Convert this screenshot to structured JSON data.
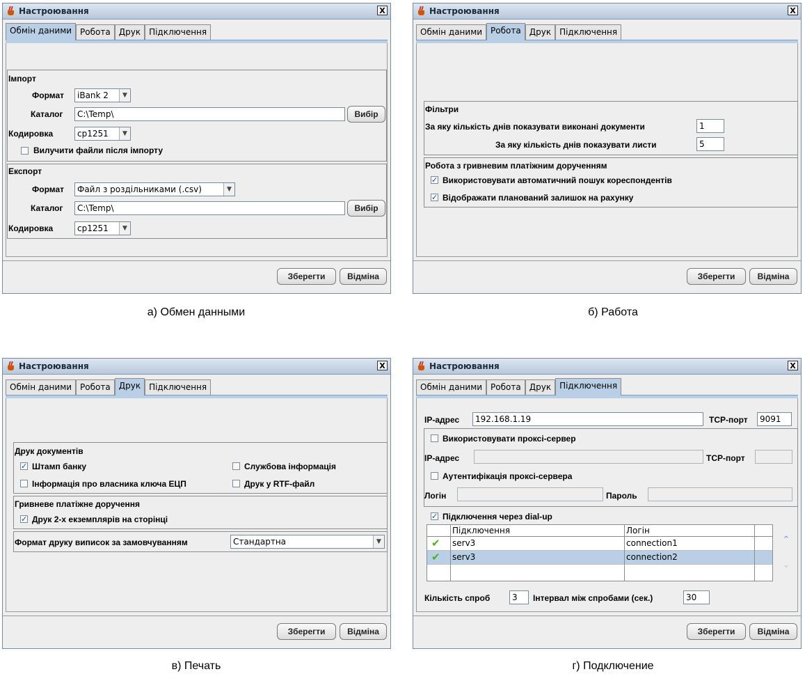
{
  "window_title": "Настроювання",
  "close_label": "X",
  "tabs": [
    "Обмін даними",
    "Робота",
    "Друк",
    "Підключення"
  ],
  "buttons": {
    "save": "Зберегти",
    "cancel": "Відміна"
  },
  "captions": {
    "a": "а) Обмен данными",
    "b": "б) Работа",
    "c": "в) Печать",
    "d": "г) Подключение"
  },
  "exchange": {
    "import": {
      "title": "Імпорт",
      "format_label": "Формат",
      "format_value": "iBank 2",
      "catalog_label": "Каталог",
      "catalog_value": "C:\\Temp\\",
      "browse": "Вибір",
      "encoding_label": "Кодировка",
      "encoding_value": "cp1251",
      "delete_label": "Вилучити файли після імпорту",
      "delete_checked": false
    },
    "export": {
      "title": "Експорт",
      "format_label": "Формат",
      "format_value": "Файл з роздільниками (.csv)",
      "catalog_label": "Каталог",
      "catalog_value": "C:\\Temp\\",
      "browse": "Вибір",
      "encoding_label": "Кодировка",
      "encoding_value": "cp1251"
    }
  },
  "work": {
    "filters": {
      "title": "Фільтри",
      "executed_label": "За яку кількість днів показувати виконані документи",
      "executed_value": "1",
      "letters_label": "За яку кількість днів показувати листи",
      "letters_value": "5"
    },
    "payment": {
      "title": "Робота з гривневим платіжним дорученням",
      "auto_search_label": "Використовувати автоматичний пошук кореспондентів",
      "auto_search_checked": true,
      "planned_balance_label": "Відображати планований залишок на рахунку",
      "planned_balance_checked": true
    }
  },
  "print": {
    "docs": {
      "title": "Друк документів",
      "stamp_label": "Штамп банку",
      "stamp_checked": true,
      "service_label": "Службова інформація",
      "service_checked": false,
      "owner_label": "Інформація про власника ключа ЕЦП",
      "owner_checked": false,
      "rtf_label": "Друк у RTF-файл",
      "rtf_checked": false
    },
    "payment": {
      "title": "Гривневе платіжне доручення",
      "two_copies_label": "Друк 2-х екземплярів на сторінці",
      "two_copies_checked": true
    },
    "statement_format_label": "Формат друку виписок за замовчуванням",
    "statement_format_value": "Стандартна"
  },
  "connection": {
    "ip_label": "IP-адрес",
    "ip_value": "192.168.1.19",
    "port_label": "TCP-порт",
    "port_value": "9091",
    "proxy": {
      "use_label": "Використовувати проксі-сервер",
      "use_checked": false,
      "ip_label": "IP-адрес",
      "ip_value": "",
      "port_label": "TCP-порт",
      "port_value": "",
      "auth_label": "Аутентифікація проксі-сервера",
      "auth_checked": false,
      "login_label": "Логін",
      "login_value": "",
      "password_label": "Пароль",
      "password_value": ""
    },
    "dialup": {
      "label": "Підключення через dial-up",
      "checked": true,
      "columns": [
        "Підключення",
        "Логін"
      ],
      "rows": [
        {
          "connection": "serv3",
          "login": "connection1",
          "selected": false
        },
        {
          "connection": "serv3",
          "login": "connection2",
          "selected": true
        }
      ]
    },
    "attempts_label": "Кількість спроб",
    "attempts_value": "3",
    "interval_label": "Інтервал між спробами (сек.)",
    "interval_value": "30"
  },
  "icons": {
    "window": "java-cup-icon",
    "close": "close-icon",
    "dropdown": "chevron-down-icon",
    "up": "arrow-up-icon",
    "down": "arrow-down-icon",
    "check": "checkmark-icon"
  }
}
